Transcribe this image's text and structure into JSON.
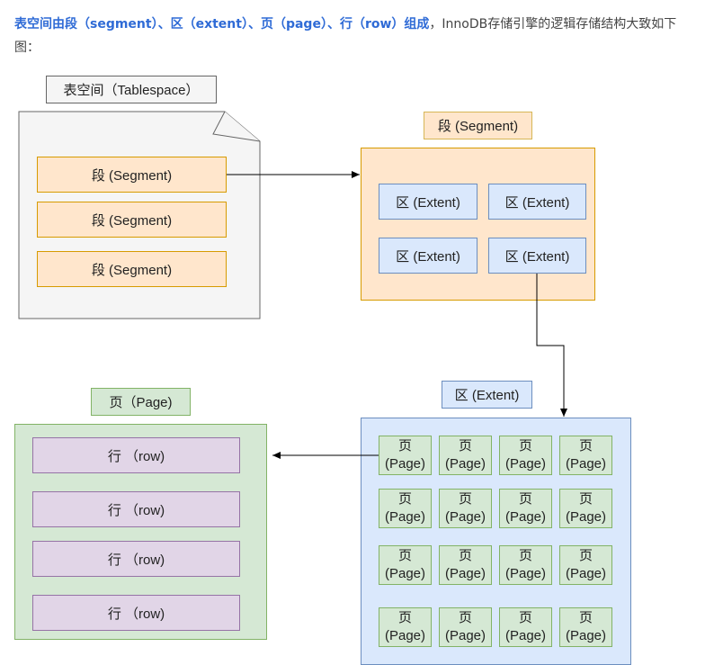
{
  "intro": {
    "bold": "表空间由段（segment）、区（extent）、页（page）、行（row）组成",
    "rest": "，InnoDB存储引擎的逻辑存储结构大致如下图："
  },
  "tablespace": {
    "title": "表空间（Tablespace）",
    "segments": [
      "段 (Segment)",
      "段 (Segment)",
      "段 (Segment)"
    ]
  },
  "segment": {
    "title": "段 (Segment)",
    "extents": [
      "区 (Extent)",
      "区 (Extent)",
      "区 (Extent)",
      "区 (Extent)"
    ]
  },
  "extent": {
    "title": "区 (Extent)",
    "page_line1": "页",
    "page_line2": "(Page)",
    "page_count": 16
  },
  "page": {
    "title": "页（Page)",
    "rows": [
      "行 （row)",
      "行 （row)",
      "行 （row)",
      "行 （row)"
    ]
  },
  "colors": {
    "orange_fill": "#ffe6cc",
    "orange_stroke": "#d79b00",
    "blue_fill": "#dae8fc",
    "blue_stroke": "#6c8ebf",
    "green_fill": "#d5e8d4",
    "green_stroke": "#82b366",
    "purple_fill": "#e1d5e7",
    "purple_stroke": "#9673a6",
    "accent_text": "#2f6bd6"
  }
}
